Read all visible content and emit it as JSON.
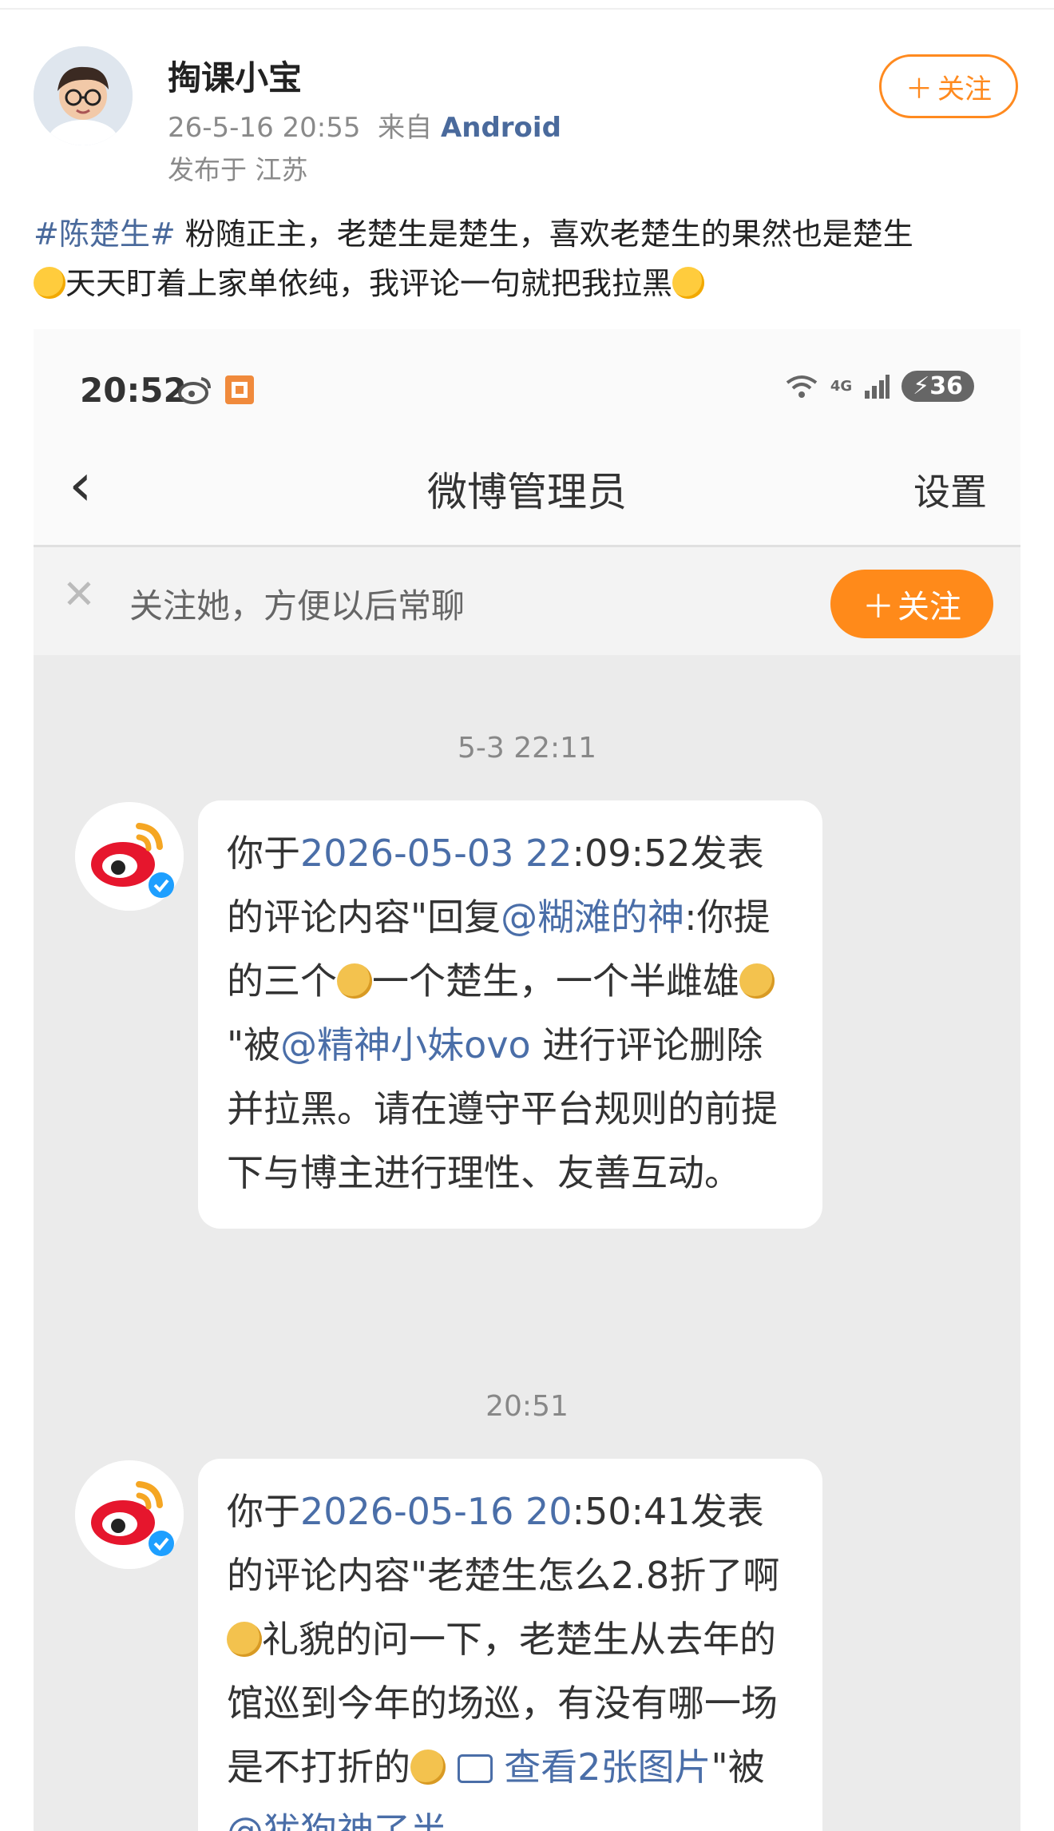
{
  "post": {
    "username": "掏课小宝",
    "time": "26-5-16 20:55",
    "from_label": "来自",
    "source": "Android",
    "location": "发布于 江苏",
    "follow_label": "关注",
    "hashtag": "#陈楚生#",
    "text_line1": " 粉随正主，老楚生是楚生，喜欢老楚生的果然也是楚生",
    "text_line2": "天天盯着上家单依纯，我评论一句就把我拉黑"
  },
  "screenshot": {
    "status_time": "20:52",
    "network": "4G",
    "battery": "36",
    "nav_title": "微博管理员",
    "nav_settings": "设置",
    "follow_prompt": "关注她，方便以后常聊",
    "follow_button": "关注",
    "messages": [
      {
        "timestamp": "5-3 22:11",
        "p1": "你于",
        "date_link": "2026-05-03 22",
        "p2": ":09:52发表的评论内容\"回复",
        "mention1": "@糊滩的神",
        "p3": ":你提的三个",
        "p4": "一个楚生，一个半雌雄",
        "p5": "\"被",
        "mention2": "@精神小妹ovo",
        "p6": " 进行评论删除并拉黑。请在遵守平台规则的前提下与博主进行理性、友善互动。"
      },
      {
        "timestamp": "20:51",
        "p1": "你于",
        "date_link": "2026-05-16 20",
        "p2": ":50:41发表的评论内容\"老楚生怎么2.8折了啊",
        "p3": "礼貌的问一下，老楚生从去年的馆巡到今年的场巡，有没有哪一场是不打折的",
        "p4_link": "查看2张图片",
        "p5": "\"被",
        "mention": "@犹狗神了半"
      }
    ]
  }
}
